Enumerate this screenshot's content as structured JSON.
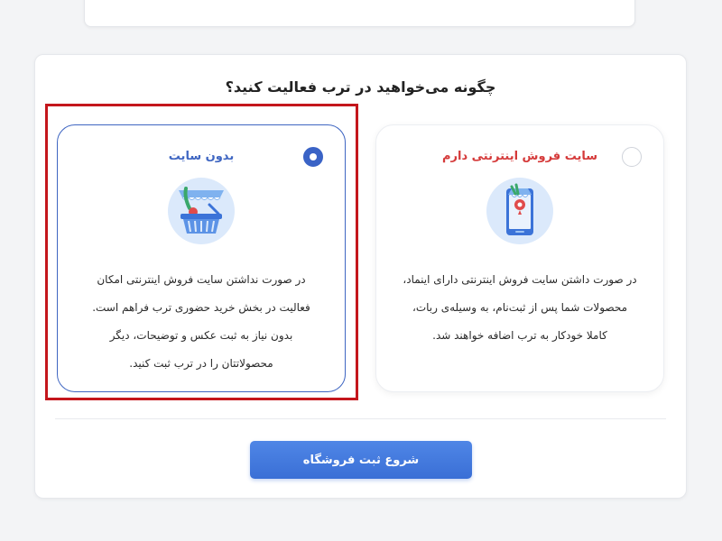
{
  "question": "چگونه می‌خواهید در ترب فعالیت کنید؟",
  "options": [
    {
      "id": "online",
      "title": "سایت فروش اینترنتی دارم",
      "selected": false,
      "icon": "online-store-phone-icon",
      "description": [
        "در صورت داشتن سایت فروش اینترنتی دارای اینماد،",
        "محصولات شما پس از ثبت‌نام، به وسیله‌ی ربات،",
        "کاملا خودکار به ترب اضافه خواهند شد."
      ]
    },
    {
      "id": "offline",
      "title": "بدون سایت",
      "selected": true,
      "icon": "shopping-basket-icon",
      "description": [
        "در صورت نداشتن سایت فروش اینترنتی امکان",
        "فعالیت در بخش خرید حضوری ترب فراهم است.",
        "بدون نیاز به ثبت عکس و توضیحات، دیگر",
        "محصولاتتان را در ترب ثبت کنید."
      ]
    }
  ],
  "start_button": "شروع ثبت فروشگاه",
  "colors": {
    "accent": "#3a63c6",
    "online_title": "#d53a3a",
    "highlight": "#c4161c",
    "button": "#3a6fd6"
  }
}
